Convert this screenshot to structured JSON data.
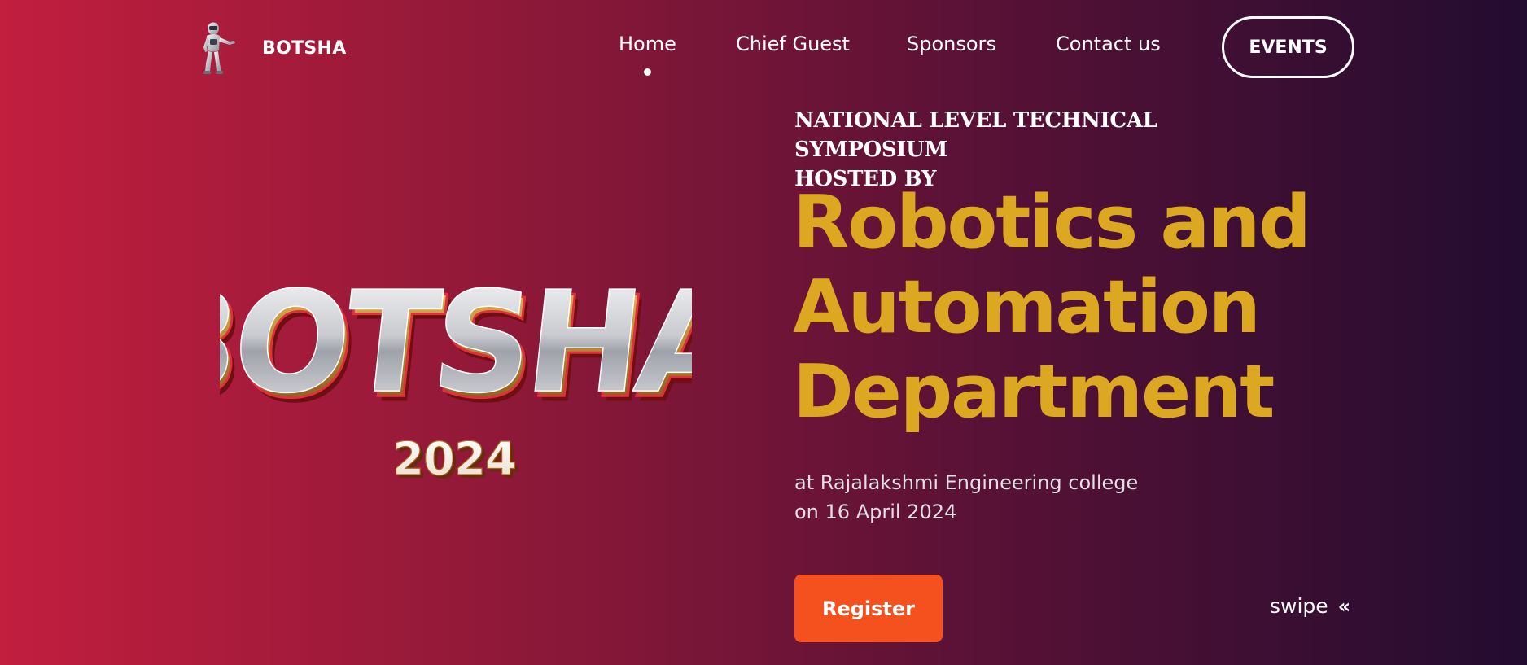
{
  "brand": {
    "name": "BOTSHA",
    "logo_icon": "robot-icon"
  },
  "nav": {
    "items": [
      {
        "label": "Home",
        "active": true
      },
      {
        "label": "Chief Guest",
        "active": false
      },
      {
        "label": "Sponsors",
        "active": false
      },
      {
        "label": "Contact us",
        "active": false
      }
    ],
    "events_button": "EVENTS"
  },
  "hero_logo": {
    "title": "BOTSHA",
    "year": "2024"
  },
  "hero": {
    "kicker_line1": "NATIONAL LEVEL TECHNICAL SYMPOSIUM",
    "kicker_line2": "HOSTED BY",
    "headline_line1": "Robotics and",
    "headline_line2": "Automation",
    "headline_line3": "Department",
    "venue": "at Rajalakshmi Engineering college",
    "date": "on 16 April 2024",
    "register_button": "Register",
    "swipe_label": "swipe",
    "swipe_icon": "double-chevron-left-icon"
  },
  "colors": {
    "gradient_start": "#c21e3e",
    "gradient_end": "#220c30",
    "headline": "#dca721",
    "register": "#f4511e"
  }
}
